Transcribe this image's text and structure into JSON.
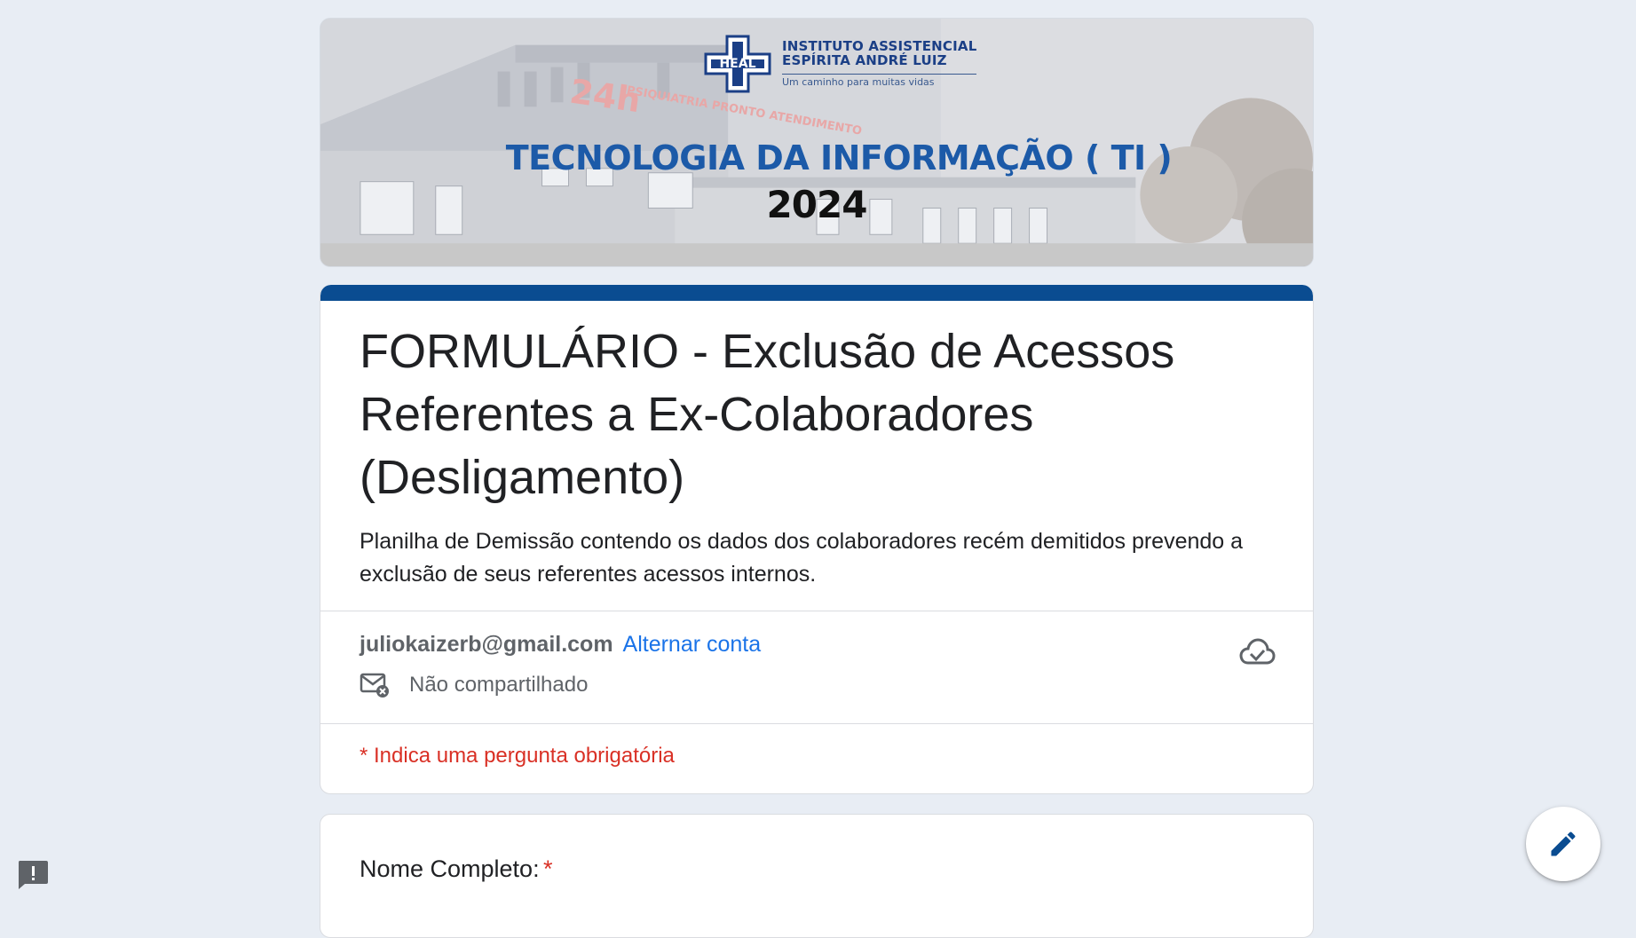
{
  "banner": {
    "logo_line1": "INSTITUTO ASSISTENCIAL",
    "logo_line2": "ESPÍRITA ANDRÉ LUIZ",
    "logo_tagline": "Um caminho para muitas vidas",
    "logo_mark_text": "HEAL",
    "sign_hours": "24h",
    "sign_text": "PSIQUIATRIA PRONTO ATENDIMENTO",
    "title": "TECNOLOGIA DA INFORMAÇÃO ( TI )",
    "year": "2024"
  },
  "form": {
    "title": "FORMULÁRIO - Exclusão de Acessos Referentes a Ex-Colaboradores (Desligamento)",
    "description": "Planilha de Demissão contendo os dados dos colaboradores recém demitidos prevendo a exclusão de seus referentes acessos internos.",
    "account_email": "juliokaizerb@gmail.com",
    "switch_account_label": "Alternar conta",
    "not_shared_label": "Não compartilhado",
    "required_note": "* Indica uma pergunta obrigatória",
    "accent_color": "#0a4c91"
  },
  "questions": [
    {
      "label": "Nome Completo:",
      "required_mark": "*"
    }
  ],
  "icons": {
    "cloud": "cloud-check-icon",
    "mail": "mail-not-shared-icon",
    "edit": "pencil-icon",
    "feedback": "feedback-icon"
  }
}
